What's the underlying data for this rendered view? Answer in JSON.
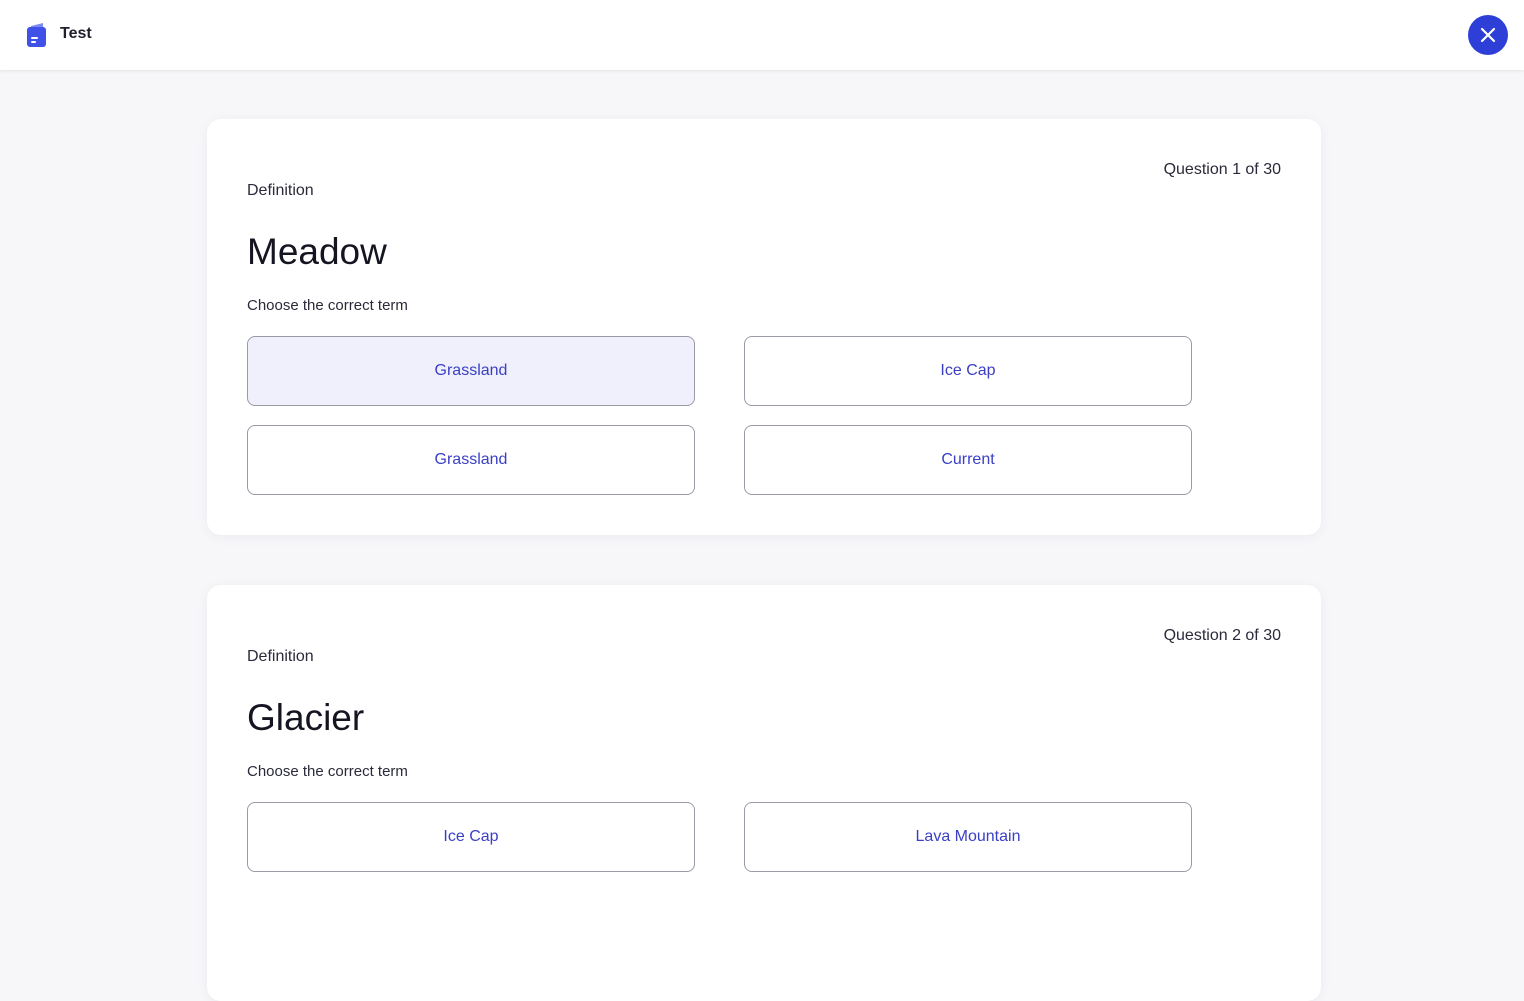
{
  "header": {
    "app_title": "Test",
    "logo_icon": "document-icon",
    "close_icon": "close-icon",
    "accent_color": "#2d3fd6"
  },
  "questions": [
    {
      "counter": "Question 1 of 30",
      "type_label": "Definition",
      "term": "Meadow",
      "instruction": "Choose the correct term",
      "options": [
        {
          "label": "Grassland",
          "selected": true
        },
        {
          "label": "Ice Cap",
          "selected": false
        },
        {
          "label": "Grassland",
          "selected": false
        },
        {
          "label": "Current",
          "selected": false
        }
      ]
    },
    {
      "counter": "Question 2 of 30",
      "type_label": "Definition",
      "term": "Glacier",
      "instruction": "Choose the correct term",
      "options": [
        {
          "label": "Ice Cap",
          "selected": false
        },
        {
          "label": "Lava Mountain",
          "selected": false
        }
      ]
    }
  ]
}
